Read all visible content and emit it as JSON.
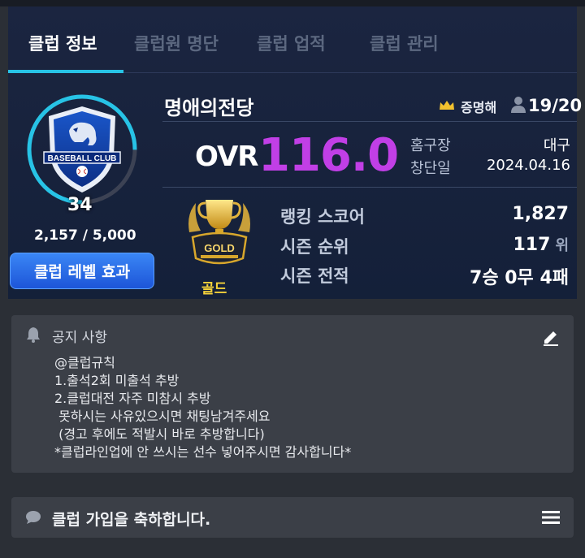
{
  "tabs": [
    {
      "label": "클럽 정보",
      "active": true
    },
    {
      "label": "클럽원 명단",
      "active": false
    },
    {
      "label": "클럽 업적",
      "active": false
    },
    {
      "label": "클럽 관리",
      "active": false
    }
  ],
  "club": {
    "name": "명애의전당",
    "leader": "증명해",
    "members": "19/20",
    "ovr_label": "OVR",
    "ovr_value": "116.0",
    "home_label": "홈구장",
    "home_value": "대구",
    "founded_label": "창단일",
    "founded_value": "2024.04.16",
    "emblem_text": "BASEBALL CLUB",
    "level": "34",
    "xp": "2,157 / 5,000",
    "xp_progress": 0.4314,
    "level_button": "클럽 레벨 효과"
  },
  "tier": {
    "badge_text": "GOLD",
    "name": "골드"
  },
  "stats": [
    {
      "label": "랭킹 스코어",
      "value": "1,827",
      "unit": ""
    },
    {
      "label": "시즌 순위",
      "value": "117",
      "unit": "위"
    },
    {
      "label": "시즌 전적",
      "value": "7승 0무 4패",
      "unit": ""
    }
  ],
  "notice": {
    "title": "공지 사항",
    "lines": [
      "@클럽규칙",
      "1.출석2회 미출석 추방",
      "2.클럽대전 자주 미참시 추방",
      " 못하시는 사유있으시면 채팅남겨주세요",
      " (경고 후에도 적발시 바로 추방합니다)",
      "*클럽라인업에 안 쓰시는 선수 넣어주시면 감사합니다*"
    ]
  },
  "greeting": "클럽 가입을 축하합니다.",
  "colors": {
    "accent": "#27c3e6",
    "ovr": "#c13fe6",
    "button": "#1d55d8",
    "gold": "#f4d13a"
  },
  "icons": [
    "crown-icon",
    "person-icon",
    "bell-icon",
    "edit-icon",
    "chat-icon",
    "menu-icon",
    "emblem-icon",
    "trophy-icon"
  ]
}
